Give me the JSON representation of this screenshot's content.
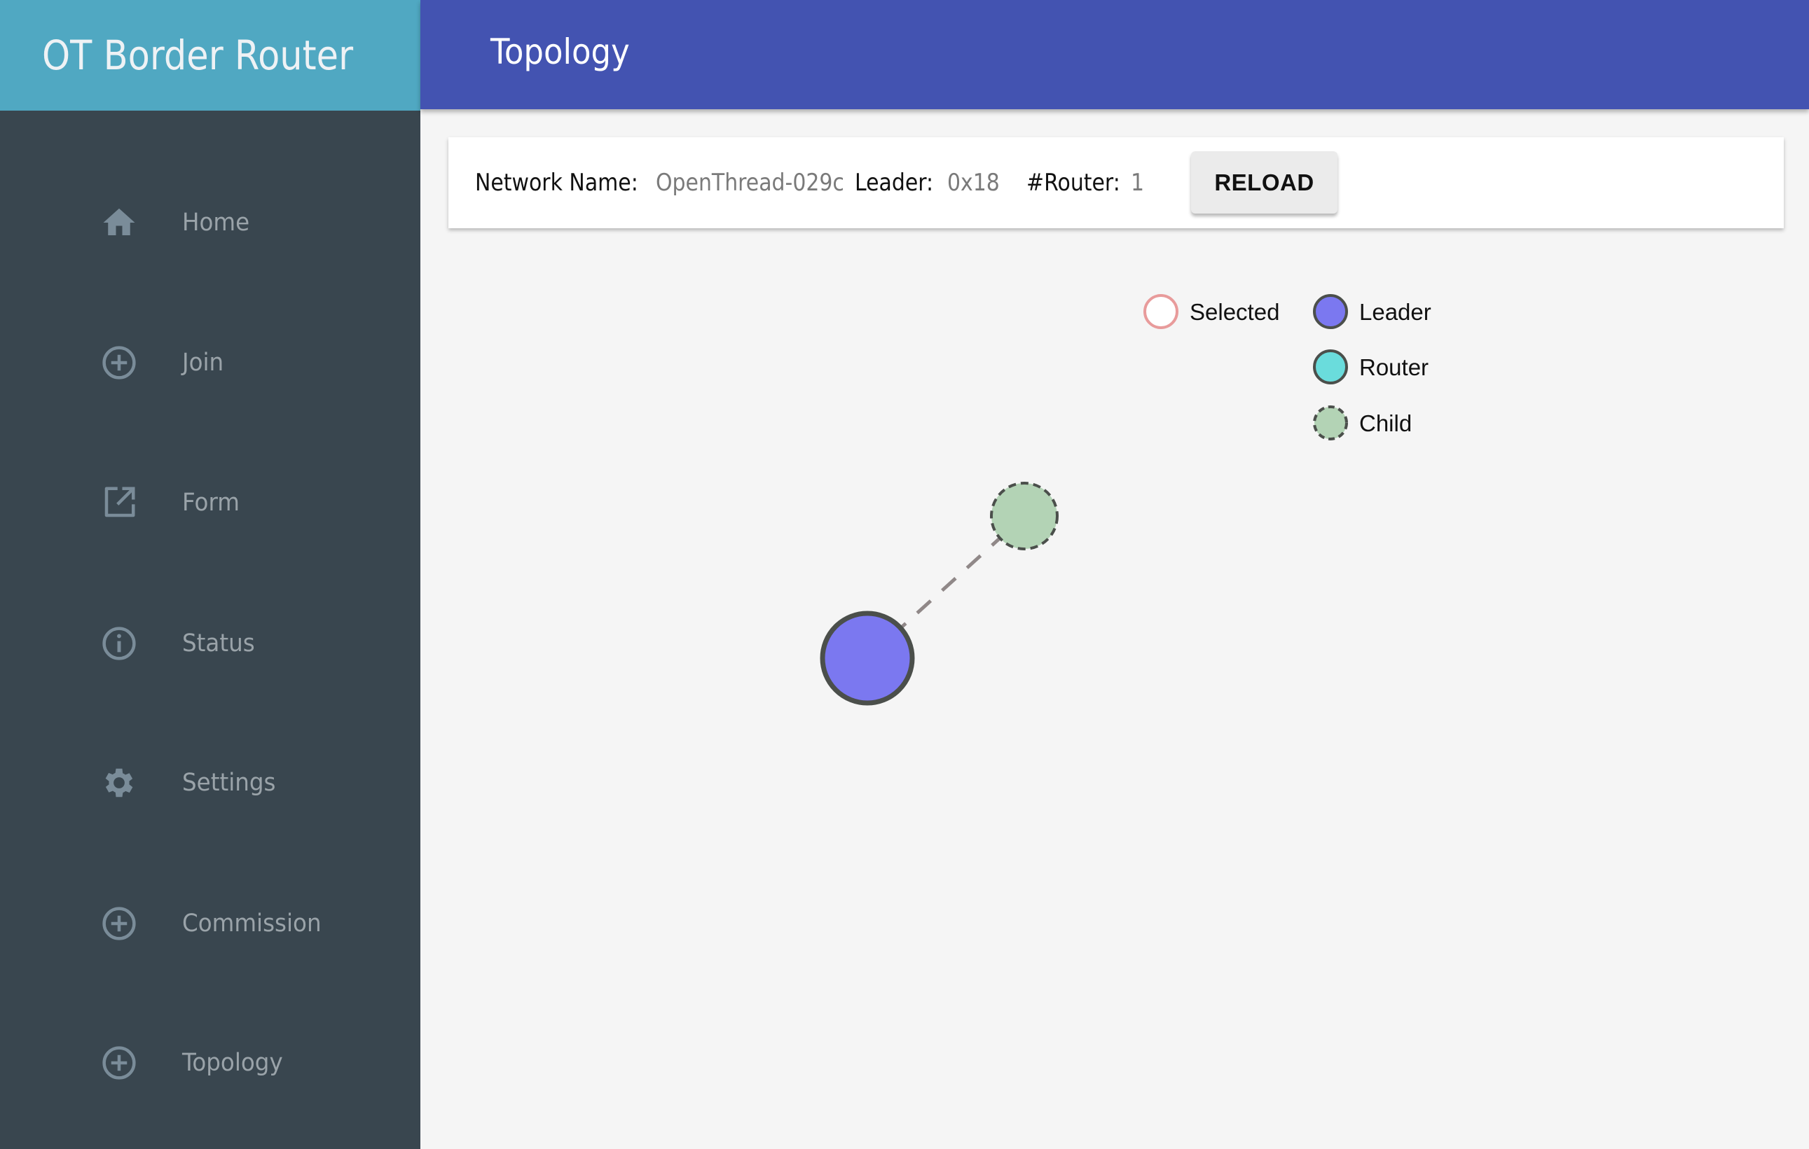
{
  "brand": {
    "title": "OT Border Router"
  },
  "header": {
    "title": "Topology"
  },
  "sidebar": {
    "items": [
      {
        "label": "Home",
        "icon": "home-icon"
      },
      {
        "label": "Join",
        "icon": "add-circle-icon"
      },
      {
        "label": "Form",
        "icon": "open-in-new-icon"
      },
      {
        "label": "Status",
        "icon": "info-icon"
      },
      {
        "label": "Settings",
        "icon": "gear-icon"
      },
      {
        "label": "Commission",
        "icon": "add-circle-icon"
      },
      {
        "label": "Topology",
        "icon": "add-circle-icon"
      }
    ]
  },
  "info": {
    "network_name_label": "Network Name:",
    "network_name_value": "OpenThread-029c",
    "leader_label": "Leader:",
    "leader_value": "0x18",
    "router_label": "#Router:",
    "router_value": "1",
    "reload_label": "RELOAD"
  },
  "legend": {
    "items": [
      {
        "label": "Selected",
        "fill": "#ffffff",
        "stroke": "#e89b9b",
        "dashed": false
      },
      {
        "label": "Leader",
        "fill": "#7b78f0",
        "stroke": "#4b4f4b",
        "dashed": false
      },
      {
        "label": "Router",
        "fill": "#6adcdc",
        "stroke": "#4b4f4b",
        "dashed": false
      },
      {
        "label": "Child",
        "fill": "#b3d3b5",
        "stroke": "#4b4f4b",
        "dashed": true
      }
    ]
  },
  "topology": {
    "nodes": [
      {
        "id": "leader",
        "role": "Leader",
        "fill": "#7b78f0",
        "stroke": "#4b4f4b"
      },
      {
        "id": "child",
        "role": "Child",
        "fill": "#b3d3b5",
        "stroke": "#4b4f4b"
      }
    ],
    "links": [
      {
        "source": "leader",
        "target": "child",
        "style": "dashed",
        "color": "#908888"
      }
    ]
  },
  "colors": {
    "brand_bg": "#50a8c2",
    "header_bg": "#4353b1",
    "sidebar_bg": "#39464f",
    "icon": "#7a8c99"
  }
}
